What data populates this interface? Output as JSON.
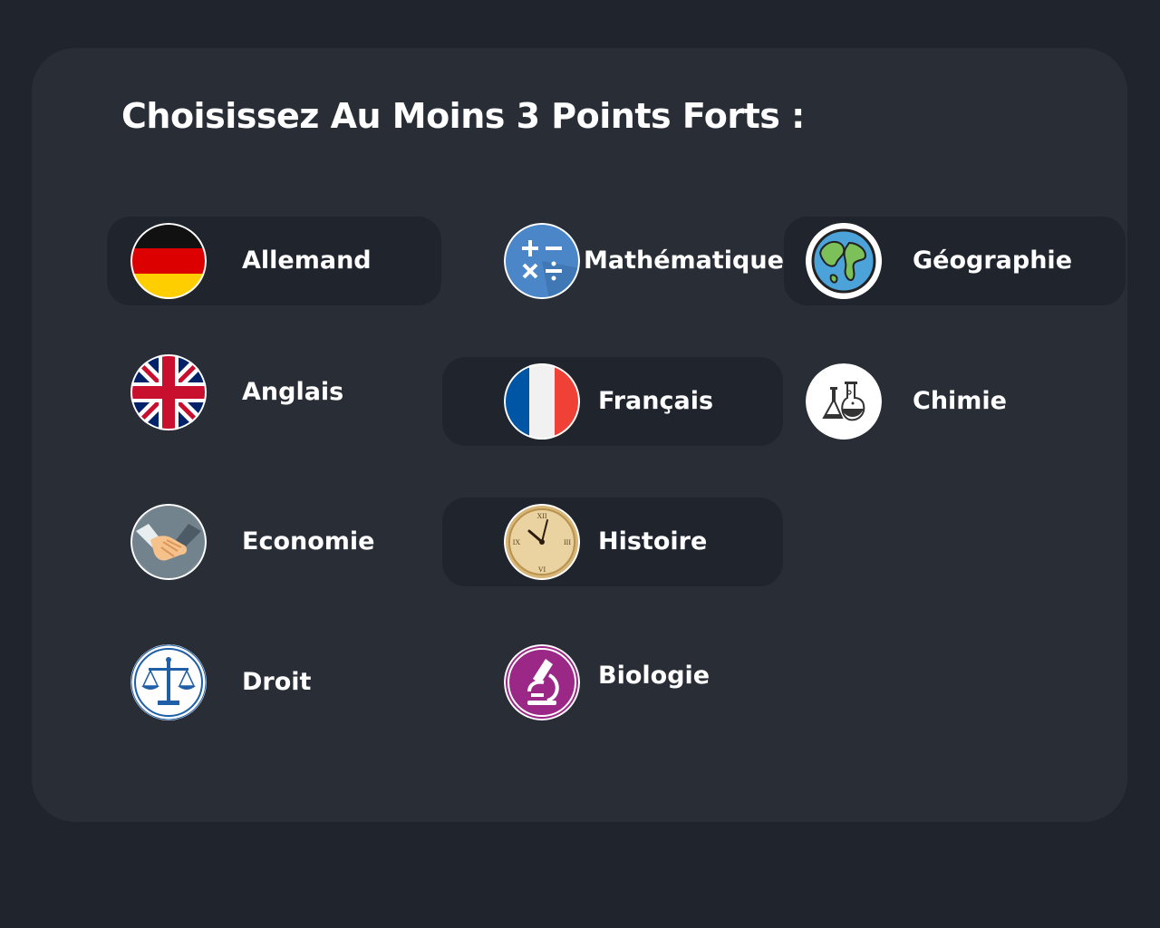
{
  "title": "Choisissez Au Moins 3 Points Forts :",
  "subjects": {
    "allemand": {
      "label": "Allemand",
      "icon": "germany-flag-icon",
      "selected": true
    },
    "anglais": {
      "label": "Anglais",
      "icon": "uk-flag-icon",
      "selected": false
    },
    "economie": {
      "label": "Economie",
      "icon": "handshake-icon",
      "selected": false
    },
    "droit": {
      "label": "Droit",
      "icon": "scales-icon",
      "selected": false
    },
    "mathematiques": {
      "label": "Mathématiques",
      "icon": "math-operators-icon",
      "selected": false
    },
    "francais": {
      "label": "Français",
      "icon": "france-flag-icon",
      "selected": true
    },
    "histoire": {
      "label": "Histoire",
      "icon": "clock-icon",
      "selected": true
    },
    "biologie": {
      "label": "Biologie",
      "icon": "microscope-icon",
      "selected": false
    },
    "geographie": {
      "label": "Géographie",
      "icon": "globe-icon",
      "selected": true
    },
    "chimie": {
      "label": "Chimie",
      "icon": "flasks-icon",
      "selected": false
    }
  },
  "colors": {
    "page_background": "#20252d",
    "card_background": "#282d36",
    "selected_background": "#20252d",
    "text": "#ffffff"
  }
}
